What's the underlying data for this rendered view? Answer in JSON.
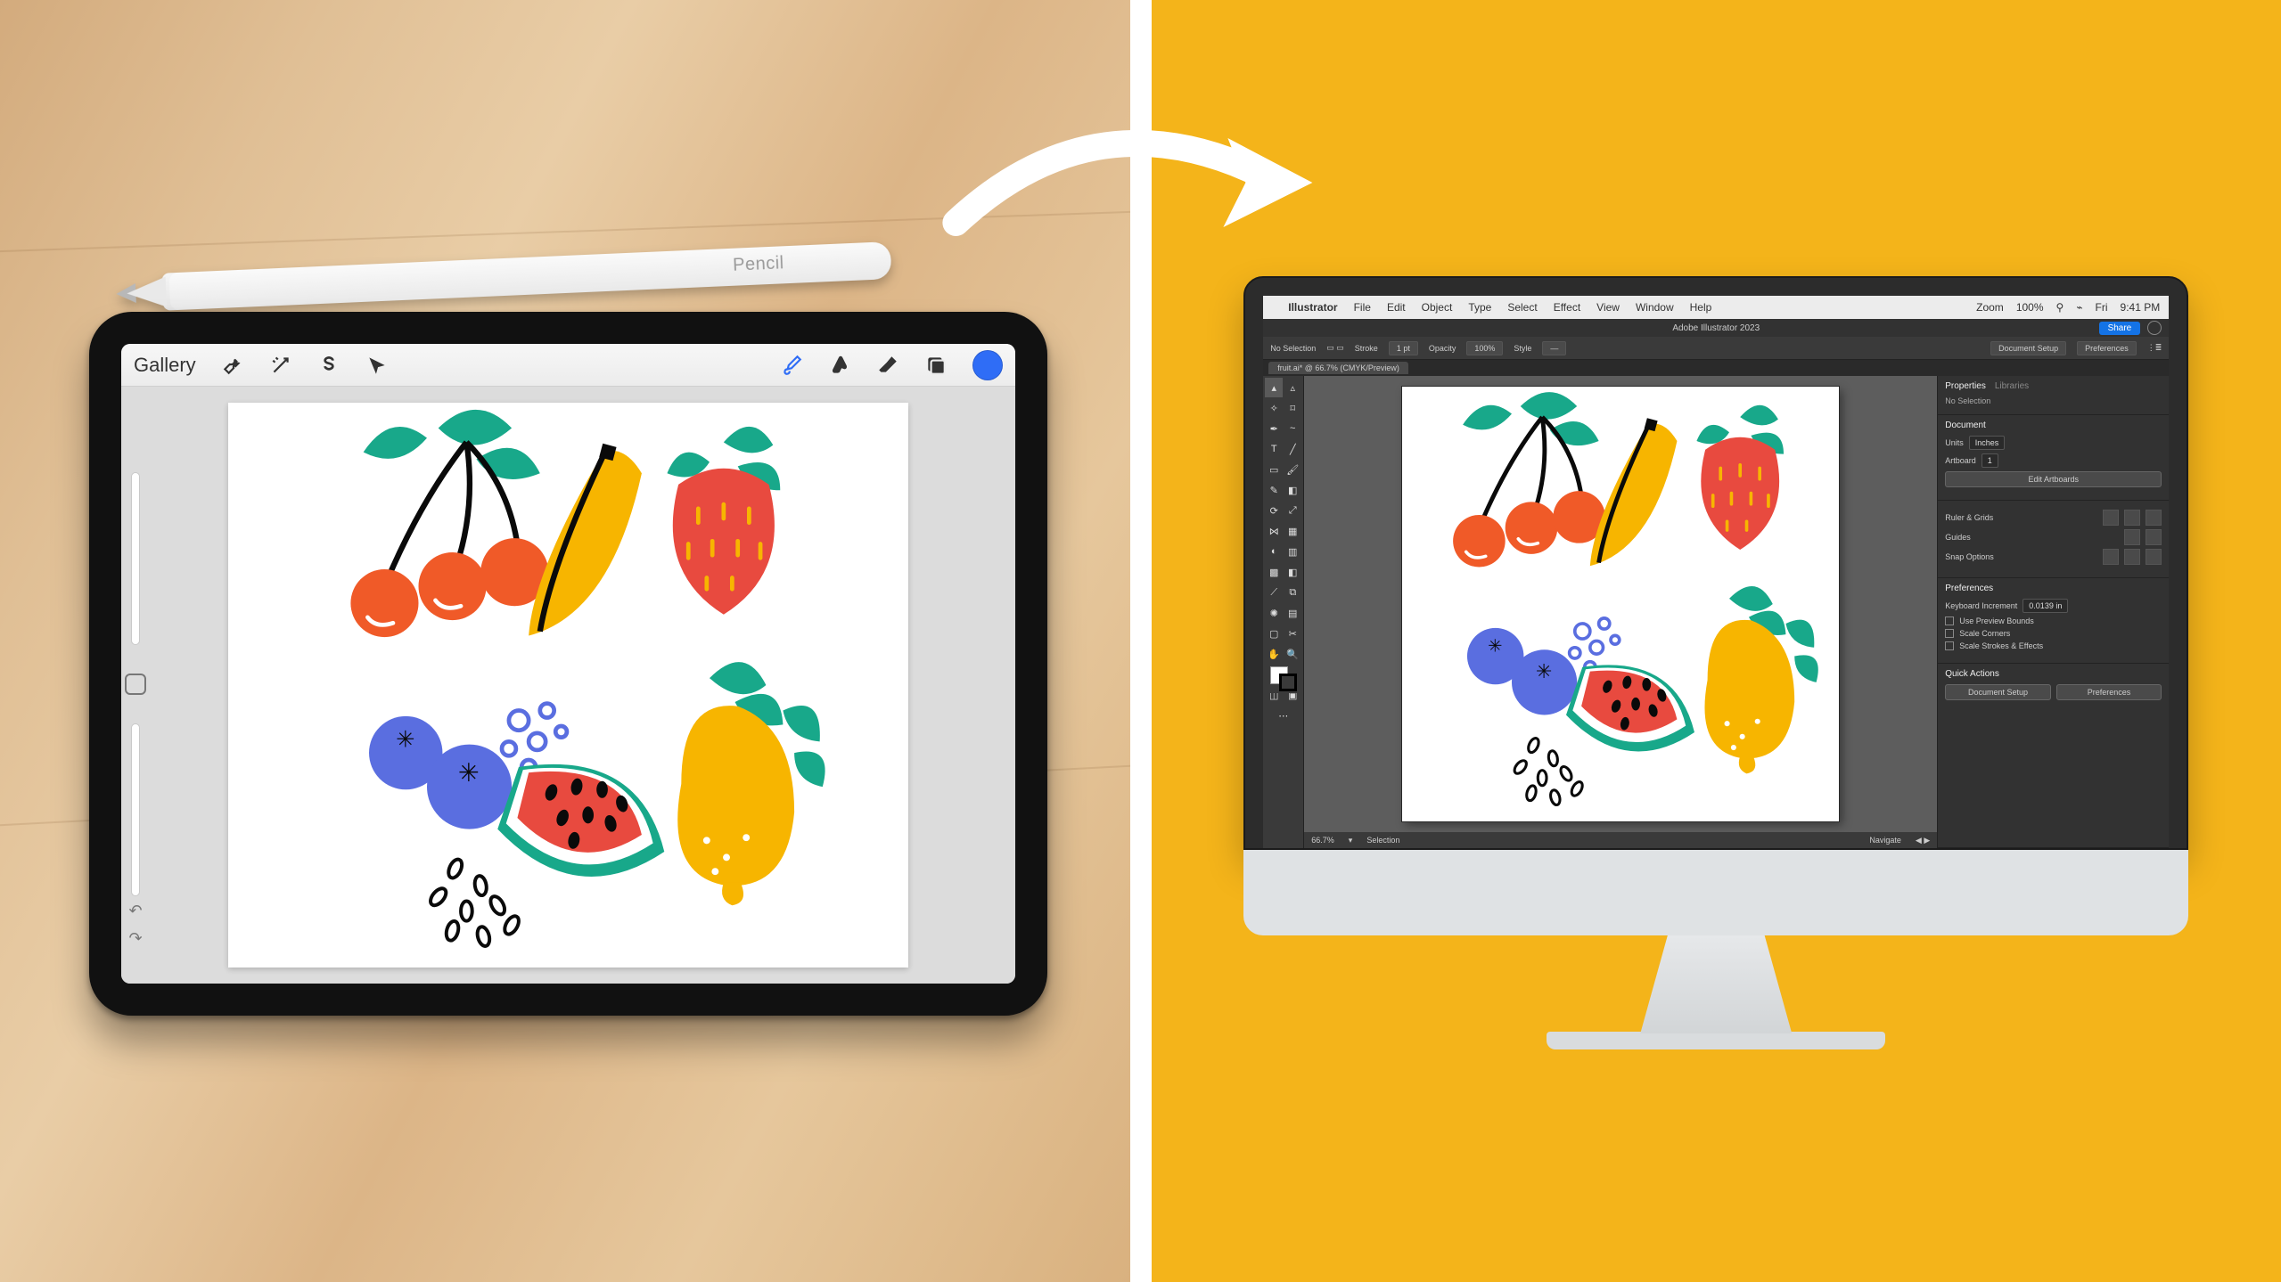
{
  "pencil": {
    "label": "Pencil"
  },
  "procreate": {
    "gallery": "Gallery",
    "tools": {
      "wrench": "wrench",
      "wand": "wand",
      "select": "select",
      "move": "move",
      "brush": "brush",
      "smudge": "smudge",
      "eraser": "eraser",
      "layers": "layers"
    }
  },
  "mac_menubar": {
    "app": "Illustrator",
    "items": [
      "File",
      "Edit",
      "Object",
      "Type",
      "Select",
      "Effect",
      "View",
      "Window",
      "Help"
    ],
    "zoom_label": "Zoom",
    "zoom_value": "100%",
    "time": "9:41 PM",
    "date": "Fri"
  },
  "illustrator": {
    "app_title": "Adobe Illustrator 2023",
    "tab_label": "fruit.ai* @ 66.7% (CMYK/Preview)",
    "control": {
      "no_selection": "No Selection",
      "stroke_label": "Stroke",
      "stroke_value": "1 pt",
      "opacity_label": "Opacity",
      "opacity_value": "100%",
      "style_label": "Style",
      "doc_setup": "Document Setup",
      "preferences": "Preferences"
    },
    "share": "Share",
    "status": {
      "zoom": "66.7%",
      "tool": "Selection",
      "nav": "Navigate"
    },
    "panels": {
      "properties_tab": "Properties",
      "libraries_tab": "Libraries",
      "no_selection": "No Selection",
      "document": "Document",
      "units_label": "Units",
      "units_value": "Inches",
      "artboard_label": "Artboard",
      "artboard_value": "1",
      "edit_artboards": "Edit Artboards",
      "ruler_grids": "Ruler & Grids",
      "guides": "Guides",
      "snap_options": "Snap Options",
      "preferences": "Preferences",
      "kb_increment": "Keyboard Increment",
      "kb_value": "0.0139 in",
      "use_preview_bounds": "Use Preview Bounds",
      "scale_corners": "Scale Corners",
      "scale_strokes": "Scale Strokes & Effects",
      "quick_actions": "Quick Actions",
      "doc_setup_btn": "Document Setup",
      "prefs_btn": "Preferences"
    }
  },
  "colors": {
    "yellow_bg": "#f4b41a",
    "procreate_blue": "#2f6df6",
    "fruit_orange": "#f05a28",
    "fruit_teal": "#18a88a",
    "fruit_yellow": "#f7b500",
    "fruit_blue": "#5a6ee0",
    "fruit_red": "#e84a3f",
    "fruit_dark": "#0a0a0a"
  }
}
